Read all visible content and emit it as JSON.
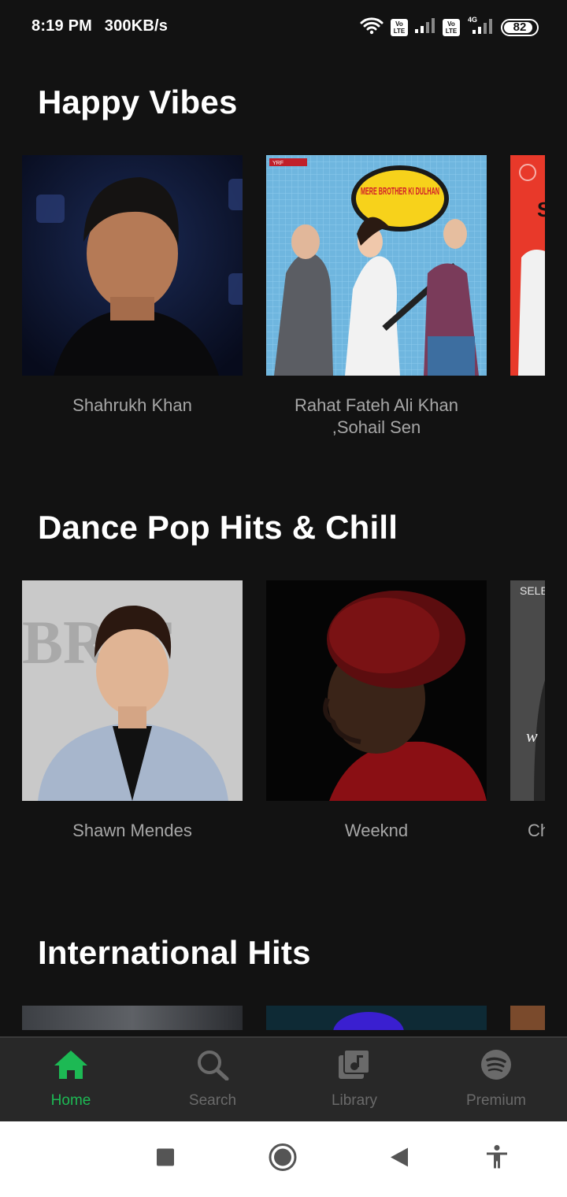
{
  "status_bar": {
    "time": "8:19 PM",
    "speed": "300KB/s",
    "network_1": "Vo LTE",
    "network_2": "Vo LTE",
    "network_type": "4G",
    "battery": "82",
    "battery_level": 0.82
  },
  "sections": [
    {
      "title": "Happy Vibes",
      "cards": [
        {
          "label": "Shahrukh Khan"
        },
        {
          "label": "Rahat Fateh Ali Khan ,Sohail Sen"
        },
        {
          "label": ""
        }
      ]
    },
    {
      "title": "Dance Pop Hits & Chill",
      "cards": [
        {
          "label": "Shawn Mendes"
        },
        {
          "label": "Weeknd"
        },
        {
          "label": "Ch"
        }
      ]
    },
    {
      "title": "International Hits",
      "cards": []
    }
  ],
  "artwork_text": {
    "poster_title": "MERE BROTHER KI DULHAN",
    "poster_studio": "YRF",
    "brit_text": "BRIT",
    "selena_text": "SELEN"
  },
  "bottom_nav": {
    "items": [
      {
        "label": "Home",
        "icon": "home-icon",
        "active": true
      },
      {
        "label": "Search",
        "icon": "search-icon",
        "active": false
      },
      {
        "label": "Library",
        "icon": "library-icon",
        "active": false
      },
      {
        "label": "Premium",
        "icon": "spotify-icon",
        "active": false
      }
    ]
  },
  "colors": {
    "background": "#121212",
    "accent": "#1db954",
    "nav_bg": "#282828",
    "inactive": "#6a6a6a"
  }
}
